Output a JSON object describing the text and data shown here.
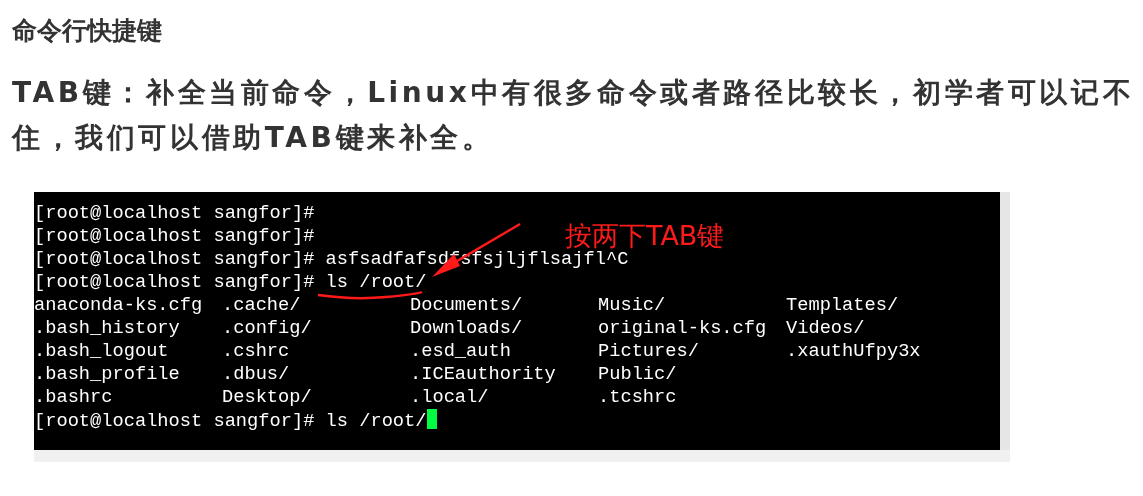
{
  "heading": "命令行快捷键",
  "paragraph": "**TAB键**：补全当前命令，Linux中有很多命令或者路径比较长，初学者可以记不住，我们可以借助TAB键来补全。",
  "terminal": {
    "lines": [
      {
        "kind": "text",
        "text": "[root@localhost sangfor]#"
      },
      {
        "kind": "text",
        "text": "[root@localhost sangfor]#"
      },
      {
        "kind": "text",
        "text": "[root@localhost sangfor]# asfsadfafsdfsfsjljflsajfl^C"
      },
      {
        "kind": "text",
        "text": "[root@localhost sangfor]# ls /root/"
      },
      {
        "kind": "grid",
        "cells": [
          "anaconda-ks.cfg",
          ".cache/",
          "Documents/",
          "Music/",
          "Templates/"
        ]
      },
      {
        "kind": "grid",
        "cells": [
          ".bash_history",
          ".config/",
          "Downloads/",
          "original-ks.cfg",
          "Videos/"
        ]
      },
      {
        "kind": "grid",
        "cells": [
          ".bash_logout",
          ".cshrc",
          ".esd_auth",
          "Pictures/",
          ".xauthUfpy3x"
        ]
      },
      {
        "kind": "grid",
        "cells": [
          ".bash_profile",
          ".dbus/",
          ".ICEauthority",
          "Public/"
        ]
      },
      {
        "kind": "grid",
        "cells": [
          ".bashrc",
          "Desktop/",
          ".local/",
          ".tcshrc"
        ]
      },
      {
        "kind": "cursor",
        "text": "[root@localhost sangfor]# ls /root/"
      }
    ],
    "annotation": "按两下TAB键"
  }
}
